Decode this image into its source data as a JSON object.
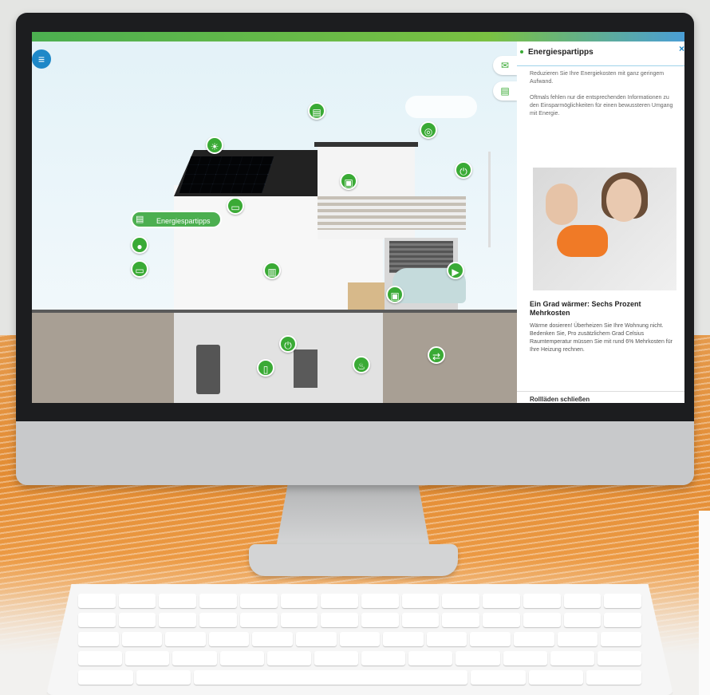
{
  "app": {
    "menu_icon": "menu-icon",
    "accent_green": "#3aaa35",
    "accent_blue": "#1e88c8"
  },
  "scene": {
    "tooltip_label": "Energiespartipps",
    "side_buttons": [
      "mail-icon",
      "tips-icon"
    ]
  },
  "panel": {
    "title": "Energiespartipps",
    "close_label": "×",
    "intro_1": "Reduzieren Sie Ihre Energiekosten mit ganz geringem Aufwand.",
    "intro_2": "Oftmals fehlen nur die entsprechenden Informationen zu den Einsparmöglichkeiten für einen bewussteren Umgang mit Energie.",
    "tip_title": "Ein Grad wärmer: Sechs Prozent Mehrkosten",
    "tip_body": "Wärme dosieren! Überheizen Sie Ihre Wohnung nicht. Bedenken Sie, Pro zusätzlichem Grad Celsius Raumtemperatur müssen Sie mit rund 6% Mehrkosten für Ihre Heizung rechnen.",
    "next_tip": "Rollläden schließen"
  }
}
